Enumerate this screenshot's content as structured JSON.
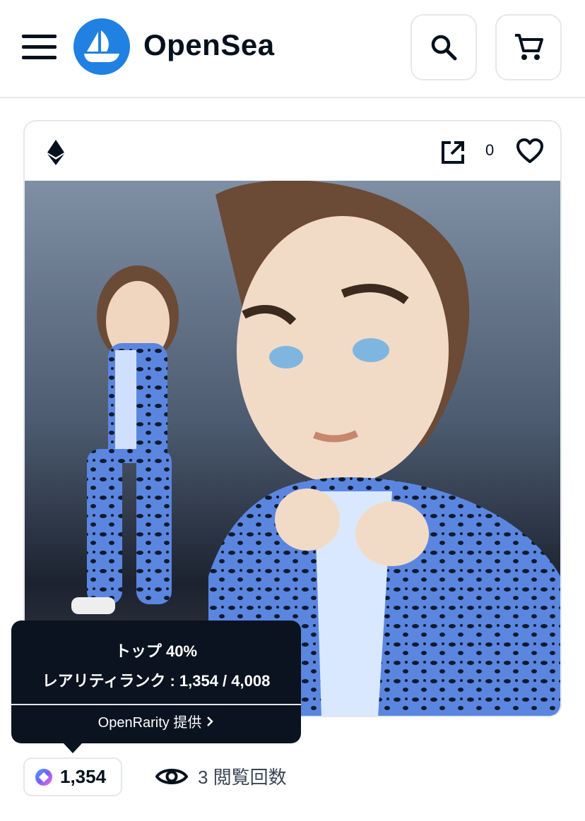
{
  "header": {
    "brand": "OpenSea",
    "icons": {
      "menu": "menu-icon",
      "logo": "opensea-logo",
      "search": "search-icon",
      "cart": "cart-icon"
    }
  },
  "card": {
    "chain_icon": "ethereum-icon",
    "favorites_count": "0",
    "icons": {
      "external_link": "external-link-icon",
      "favorite": "heart-icon"
    }
  },
  "tooltip": {
    "line1": "トップ 40%",
    "line2": "レアリティランク : 1,354 / 4,008",
    "link_label": "OpenRarity 提供"
  },
  "stats": {
    "rarity_rank": "1,354",
    "views": "3 閲覧回数"
  },
  "colors": {
    "brand": "#2081e2",
    "tooltip_bg": "#0b1320",
    "border": "#e5e8eb",
    "text": "#04111d"
  }
}
